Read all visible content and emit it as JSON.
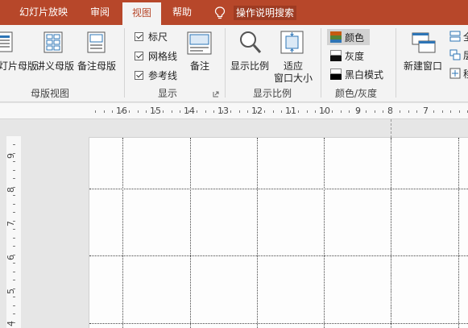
{
  "tabs": {
    "slideshow": "幻灯片放映",
    "review": "审阅",
    "view": "视图",
    "help": "帮助",
    "tell_me": "操作说明搜索"
  },
  "ribbon": {
    "master_views": {
      "slide_master": "灯片母版",
      "handout_master": "讲义母版",
      "notes_master": "备注母版",
      "group": "母版视图"
    },
    "show": {
      "ruler": "标尺",
      "gridlines": "网格线",
      "guides": "参考线",
      "notes": "备注",
      "group": "显示"
    },
    "zoom": {
      "zoom": "显示比例",
      "fit_line1": "适应",
      "fit_line2": "窗口大小",
      "group": "显示比例"
    },
    "color": {
      "color": "颜色",
      "grayscale": "灰度",
      "bw": "黑白模式",
      "group": "颜色/灰度"
    },
    "window": {
      "new_window": "新建窗口",
      "arrange_all": "全",
      "cascade": "层",
      "move_split": "移"
    }
  },
  "ruler": {
    "h_labels": [
      "16",
      "15",
      "14",
      "13",
      "12",
      "11",
      "10",
      "9",
      "8",
      "7"
    ],
    "v_labels": [
      "9",
      "8",
      "7",
      "6",
      "5",
      "4"
    ]
  },
  "colors": {
    "accent": "#b7472a",
    "ribbon_bg": "#f3f3f3",
    "workspace_bg": "#e6e6e6"
  }
}
